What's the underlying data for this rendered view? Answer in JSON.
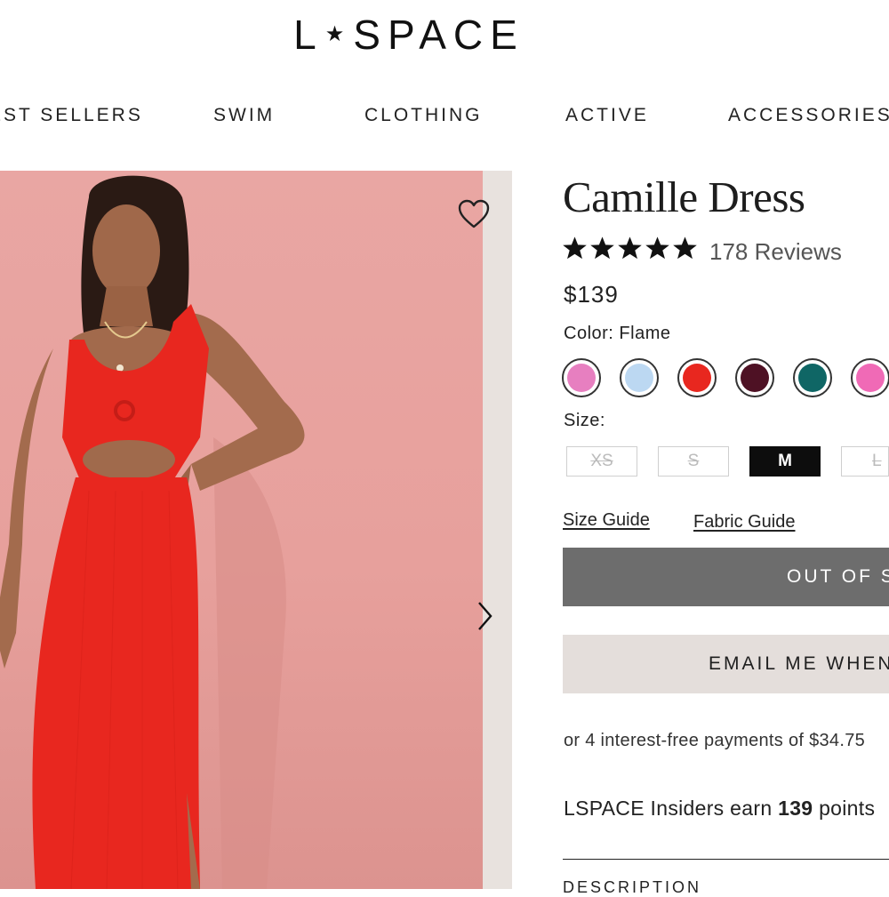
{
  "header": {
    "logo_left": "L",
    "logo_star": "★",
    "logo_right": "SPACE"
  },
  "nav": {
    "items": [
      {
        "label": "BEST SELLERS"
      },
      {
        "label": "SWIM"
      },
      {
        "label": "CLOTHING"
      },
      {
        "label": "ACTIVE"
      },
      {
        "label": "ACCESSORIES +"
      }
    ]
  },
  "gallery": {
    "favorite_icon": "heart-icon",
    "next_icon": "chevron-right-icon",
    "dress_color": "#e8271f",
    "background_color": "#e9a6a3"
  },
  "product": {
    "title": "Camille Dress",
    "rating_stars": 5,
    "reviews": "178 Reviews",
    "price": "$139",
    "color_label": "Color: Flame",
    "swatches": [
      {
        "color": "#e77fc0"
      },
      {
        "color": "#bcd8f2"
      },
      {
        "color": "#e8271f"
      },
      {
        "color": "#4e1124"
      },
      {
        "color": "#0f6665"
      },
      {
        "color": "#f06ab6"
      }
    ],
    "size_label": "Size:",
    "sizes": [
      {
        "label": "XS",
        "available": false
      },
      {
        "label": "S",
        "available": false
      },
      {
        "label": "M",
        "available": true,
        "selected": true
      },
      {
        "label": "L",
        "available": false
      }
    ],
    "size_guide": "Size Guide",
    "fabric_guide": "Fabric Guide",
    "out_of_stock_button": "OUT OF S",
    "email_button": "EMAIL ME WHEN",
    "installments": "or 4 interest-free payments of $34.75",
    "insiders_prefix": "LSPACE Insiders earn",
    "insiders_points": "139",
    "insiders_suffix": "points",
    "description_tab": "DESCRIPTION"
  },
  "colors": {
    "accent_dark": "#0d0d0d",
    "button_gray": "#6d6d6d",
    "button_light": "#e4dedb"
  }
}
